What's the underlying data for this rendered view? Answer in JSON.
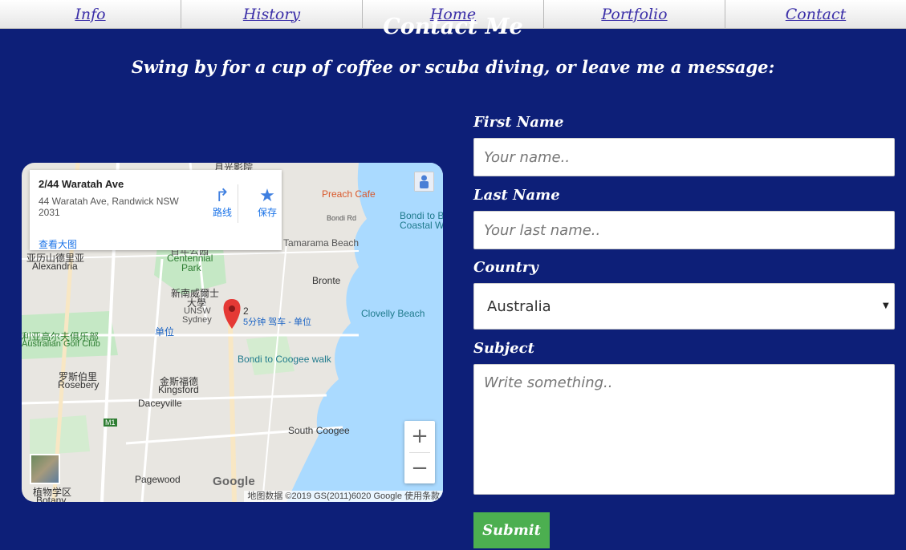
{
  "nav": {
    "items": [
      "Info",
      "History",
      "Home",
      "Portfolio",
      "Contact"
    ]
  },
  "page": {
    "title": "Contact Me",
    "tagline": "Swing by for a cup of coffee or scuba diving, or leave me a message:"
  },
  "map": {
    "info_card": {
      "title": "2/44 Waratah Ave",
      "address": "44 Waratah Ave, Randwick NSW 2031",
      "directions_label": "路线",
      "save_label": "保存",
      "view_larger_label": "查看大图"
    },
    "labels": {
      "preach_cafe": "Preach Cafe",
      "bondi_coastal_1": "Bondi to B",
      "bondi_coastal_2": "Coastal W",
      "bondi_rd": "Bondi Rd",
      "tamarama": "Tamarama Beach",
      "centennial_cn": "百年公园",
      "centennial_1": "Centennial",
      "centennial_2": "Park",
      "alexandria_cn": "亚历山德里亚",
      "alexandria": "Alexandria",
      "bronte": "Bronte",
      "unsw_cn_1": "新南威爾士",
      "unsw_cn_2": "大學",
      "unsw_1": "UNSW",
      "unsw_2": "Sydney",
      "unit_cn": "单位",
      "clovelly": "Clovelly Beach",
      "golf_cn": "利亚高尔夫俱乐部",
      "golf": "Australian Golf Club",
      "transit": "5分钟 驾车 - 单位",
      "marker_num": "2",
      "coogee_walk": "Bondi to Coogee walk",
      "rosebery_cn": "罗斯伯里",
      "rosebery": "Rosebery",
      "kingsford_cn": "金斯福德",
      "kingsford": "Kingsford",
      "daceyville": "Daceyville",
      "south_coogee": "South Coogee",
      "pagewood": "Pagewood",
      "botany_cn": "植物学区",
      "botany": "Botany",
      "m1": "M1",
      "top_cn": "月光影院"
    },
    "google_logo": "Google",
    "attribution": "地图数据 ©2019 GS(2011)6020 Google   使用条款",
    "zoom_in": "+",
    "zoom_out": "−"
  },
  "form": {
    "first_name_label": "First Name",
    "first_name_placeholder": "Your name..",
    "last_name_label": "Last Name",
    "last_name_placeholder": "Your last name..",
    "country_label": "Country",
    "country_selected": "Australia",
    "subject_label": "Subject",
    "subject_placeholder": "Write something..",
    "submit_label": "Submit"
  }
}
